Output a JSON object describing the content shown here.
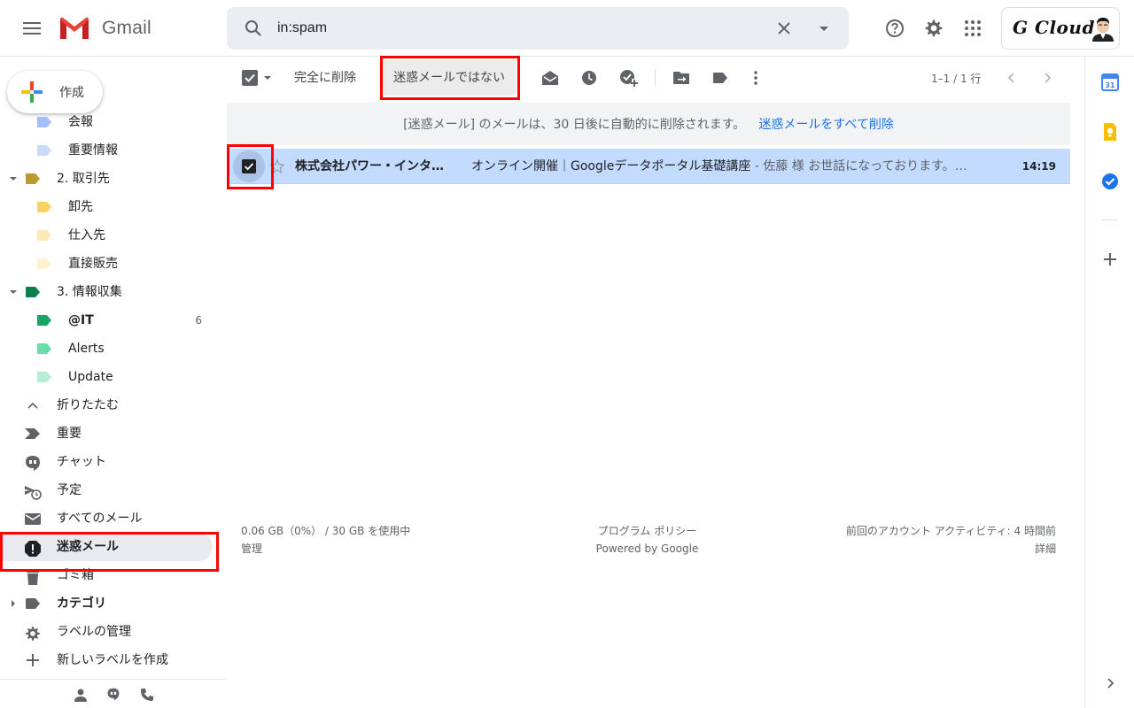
{
  "header": {
    "app_name": "Gmail",
    "search_value": "in:spam",
    "account_brand": "G Cloud"
  },
  "compose": {
    "label": "作成"
  },
  "sidebar": {
    "items": [
      {
        "label": "会報",
        "icon": "label-icon",
        "color": "#a4bdfc"
      },
      {
        "label": "重要情報",
        "icon": "label-icon",
        "color": "#c9daf8"
      },
      {
        "label": "2. 取引先",
        "icon": "label-icon",
        "color": "#b99a2e"
      },
      {
        "label": "卸先",
        "icon": "label-icon",
        "color": "#fad165"
      },
      {
        "label": "仕入先",
        "icon": "label-icon",
        "color": "#fce8b3"
      },
      {
        "label": "直接販売",
        "icon": "label-icon",
        "color": "#fef1d1"
      },
      {
        "label": "3. 情報収集",
        "icon": "label-icon",
        "color": "#0b804b"
      },
      {
        "label": "@IT",
        "count": "6",
        "icon": "label-icon",
        "color": "#16a766"
      },
      {
        "label": "Alerts",
        "icon": "label-icon",
        "color": "#68dfa9"
      },
      {
        "label": "Update",
        "icon": "label-icon",
        "color": "#b3efd3"
      },
      {
        "label": "折りたたむ",
        "icon": "chevron-up-icon"
      },
      {
        "label": "重要",
        "icon": "important-icon"
      },
      {
        "label": "チャット",
        "icon": "chat-icon"
      },
      {
        "label": "予定",
        "icon": "scheduled-icon"
      },
      {
        "label": "すべてのメール",
        "icon": "mail-icon"
      },
      {
        "label": "迷惑メール",
        "icon": "spam-icon"
      },
      {
        "label": "ゴミ箱",
        "icon": "trash-icon"
      },
      {
        "label": "カテゴリ",
        "icon": "label-icon"
      },
      {
        "label": "ラベルの管理",
        "icon": "gear-icon"
      },
      {
        "label": "新しいラベルを作成",
        "icon": "plus-icon"
      }
    ]
  },
  "toolbar": {
    "delete_forever": "完全に削除",
    "not_spam": "迷惑メールではない",
    "pagination": "1–1 / 1 行"
  },
  "banner": {
    "text": "[迷惑メール] のメールは、30 日後に自動的に削除されます。",
    "link": "迷惑メールをすべて削除"
  },
  "messages": [
    {
      "sender": "株式会社パワー・インタ…",
      "subject": "オンライン開催｜Googleデータポータル基礎講座",
      "snippet": " - 佐藤 様 お世話になっております。…",
      "time": "14:19"
    }
  ],
  "footer": {
    "storage": "0.06 GB（0%） / 30 GB を使用中",
    "manage": "管理",
    "policy": "プログラム ポリシー",
    "powered": "Powered by Google",
    "activity": "前回のアカウント アクティビティ: 4 時間前",
    "details": "詳細"
  },
  "colors": {
    "selected_row": "#c2dbff",
    "highlight": "#ff0000",
    "link": "#1a73e8"
  }
}
